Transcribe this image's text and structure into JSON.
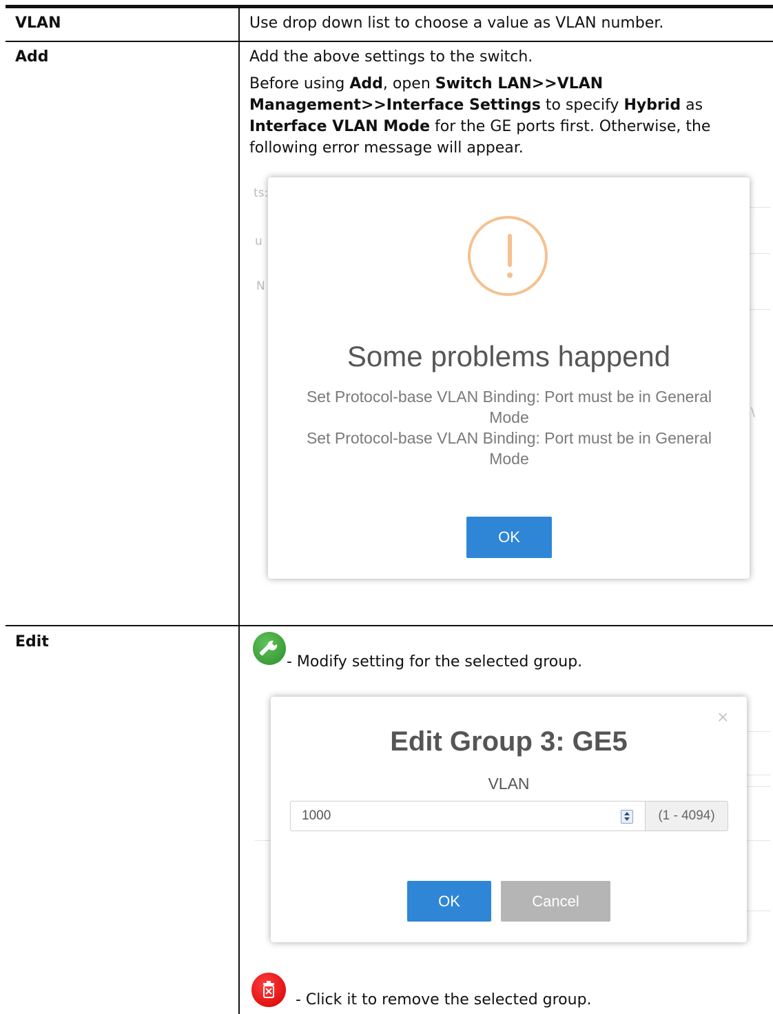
{
  "rows": {
    "vlan": {
      "term": "VLAN",
      "desc": "Use drop down list to choose a value as VLAN number."
    },
    "add": {
      "term": "Add",
      "line1": "Add the above settings to the switch.",
      "p": {
        "t1": "Before using ",
        "b1": "Add",
        "t2": ", open ",
        "b2": "Switch LAN>>VLAN",
        "b3": "Management>>Interface Settings",
        "t3": " to specify ",
        "b4": "Hybrid",
        "t4": " as",
        "b5": "Interface VLAN Mode",
        "t5": " for the GE ports first. Otherwise, the",
        "t6": "following error message will appear."
      }
    },
    "edit": {
      "term": "Edit",
      "modify_text": "- Modify setting for the selected group.",
      "remove_text": "- Click it to remove the selected group."
    }
  },
  "error_dialog": {
    "title": "Some problems happend",
    "msg_line1": "Set Protocol-base VLAN Binding: Port must be in General",
    "msg_line2": "Mode",
    "msg_line3": "Set Protocol-base VLAN Binding: Port must be in General",
    "msg_line4": "Mode",
    "ok_label": "OK",
    "background_fragments": [
      "ts:",
      "u",
      "N",
      "\\"
    ]
  },
  "edit_dialog": {
    "title": "Edit Group 3: GE5",
    "field_label": "VLAN",
    "vlan_value": "1000",
    "range_hint": "(1 - 4094)",
    "ok_label": "OK",
    "cancel_label": "Cancel"
  },
  "icons": {
    "edit": "wrench-icon",
    "delete": "trash-icon",
    "warning": "exclamation-icon",
    "close": "close-icon"
  },
  "colors": {
    "primary_button": "#2f86d6",
    "cancel_button": "#b5b5b5",
    "warning": "#f6c08f",
    "edit_icon": "#3aa335",
    "delete_icon": "#e00000"
  }
}
